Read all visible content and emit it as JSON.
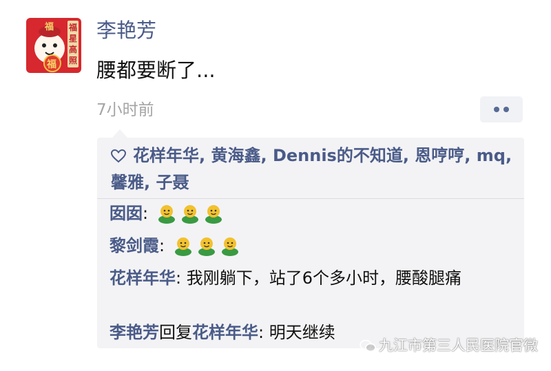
{
  "post": {
    "author": "李艳芳",
    "text": "腰都要断了...",
    "time": "7小时前",
    "avatar_text": {
      "top": "福",
      "side": "福星高照",
      "badge": "福"
    }
  },
  "likes": {
    "names": [
      "花样年华",
      "黄海鑫",
      "Dennis的不知道",
      "恩哼哼",
      "mq",
      "馨雅",
      "子聂"
    ],
    "text": "花样年华, 黄海鑫, Dennis的不知道, 恩哼哼, mq, 馨雅, 子聂"
  },
  "comments": [
    {
      "name": "囡囡",
      "colon": ": ",
      "emoji": "smiling-figure-icon",
      "emoji_count": 3
    },
    {
      "name": "黎剑霞",
      "colon": ": ",
      "emoji": "smiling-figure-icon",
      "emoji_count": 3
    },
    {
      "name": "花样年华",
      "colon": ": ",
      "text": "我刚躺下，站了6个多小时，腰酸腿痛"
    },
    {
      "name": "李艳芳",
      "reply_word": "回复",
      "reply_to": "花样年华",
      "colon": ": ",
      "text": "明天继续"
    }
  ],
  "watermark": "九江市第三人民医院官微",
  "colors": {
    "link": "#4a5b88",
    "panel": "#f3f3f5",
    "time": "#a5a5a5",
    "emoji": "#f2c12e",
    "emoji_body": "#3a9a42"
  }
}
